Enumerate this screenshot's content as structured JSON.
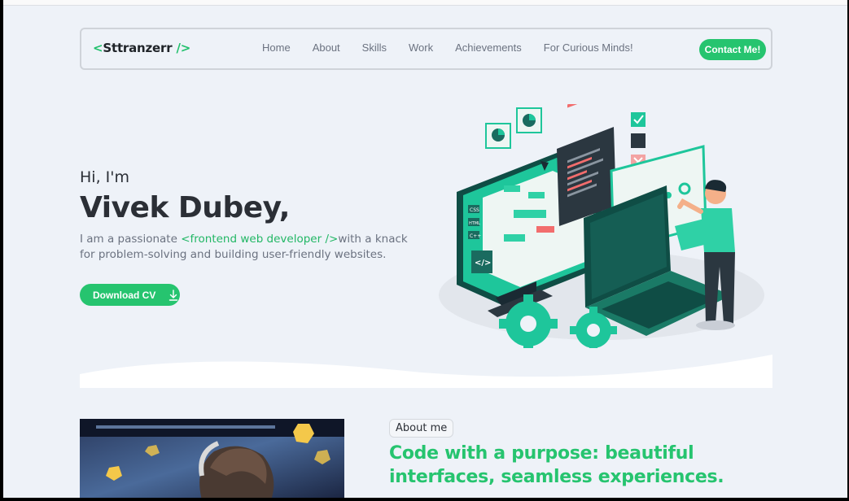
{
  "nav": {
    "logo": {
      "open": "<",
      "name": "Sttranzerr",
      "close": "/>"
    },
    "links": [
      "Home",
      "About",
      "Skills",
      "Work",
      "Achievements",
      "For Curious Minds!"
    ],
    "contact_label": "Contact Me!"
  },
  "hero": {
    "greeting": "Hi, I'm",
    "name": "Vivek Dubey,",
    "desc_prefix": "I am a passionate ",
    "desc_highlight": "<frontend web developer />",
    "desc_suffix": "with a knack for problem-solving and building user-friendly websites.",
    "cv_label": "Download CV",
    "illustration_labels": [
      "CSS",
      "HTML",
      "C++",
      "</>"
    ]
  },
  "about": {
    "tag": "About me",
    "heading": "Code with a purpose: beautiful interfaces, seamless experiences."
  },
  "colors": {
    "accent": "#26c46f",
    "background": "#eef2f8",
    "text": "#2b2f36"
  }
}
